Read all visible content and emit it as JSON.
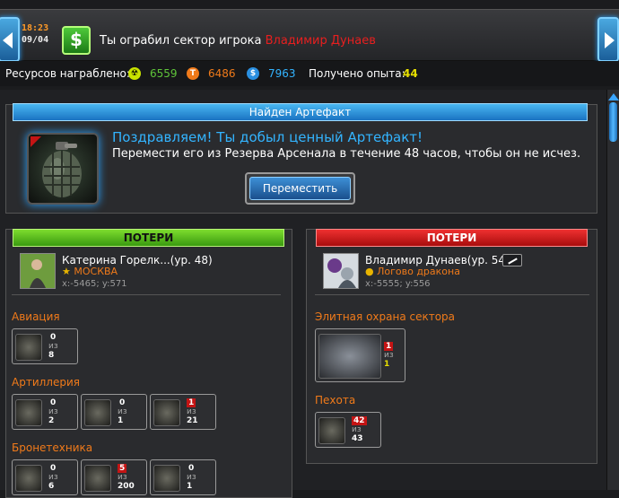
{
  "topbar": {
    "time": "18:23",
    "date": "09/04",
    "event_text": "Ты ограбил сектор игрока",
    "event_player": "Владимир Дунаев",
    "cash_icon": "dollar-sign-icon"
  },
  "resources": {
    "label": "Ресурсов награблено:",
    "items": [
      {
        "icon": "radiation-icon",
        "value": "6559",
        "color": "#5fc43a"
      },
      {
        "icon": "titanium-icon",
        "value": "6486",
        "color": "#f07a1a"
      },
      {
        "icon": "credits-icon",
        "value": "7963",
        "color": "#33b4ff"
      }
    ],
    "exp_label": "Получено опыта:",
    "exp_value": "44",
    "exp_color": "#e8e000"
  },
  "artifact": {
    "header": "Найден Артефакт",
    "title": "Поздравляем! Ты добыл ценный Артефакт!",
    "desc": "Перемести его из Резерва Арсенала в течение 48 часов, чтобы он не исчез.",
    "move_button": "Переместить"
  },
  "left": {
    "header": "ПОТЕРИ",
    "player": {
      "name": "Катерина Горелк...(ур. 48)",
      "city": "МОСКВА",
      "coords": "x:-5465; y:571"
    },
    "categories": [
      {
        "name": "Авиация",
        "units": [
          {
            "count": "0",
            "of": "из",
            "total": "8",
            "loss": false
          }
        ]
      },
      {
        "name": "Артиллерия",
        "units": [
          {
            "count": "0",
            "of": "из",
            "total": "2",
            "loss": false
          },
          {
            "count": "0",
            "of": "из",
            "total": "1",
            "loss": false
          },
          {
            "count": "1",
            "of": "из",
            "total": "21",
            "loss": true
          }
        ]
      },
      {
        "name": "Бронетехника",
        "units": [
          {
            "count": "0",
            "of": "из",
            "total": "6",
            "loss": false
          },
          {
            "count": "5",
            "of": "из",
            "total": "200",
            "loss": true
          },
          {
            "count": "0",
            "of": "из",
            "total": "1",
            "loss": false
          }
        ]
      }
    ]
  },
  "right": {
    "header": "ПОТЕРИ",
    "player": {
      "name": "Владимир Дунаев(ур. 54)",
      "city": "Логово дракона",
      "coords": "x:-5555; y:556"
    },
    "categories": [
      {
        "name": "Элитная охрана сектора",
        "units": [
          {
            "count": "1",
            "of": "из",
            "total": "1",
            "loss": true
          }
        ]
      },
      {
        "name": "Пехота",
        "units": [
          {
            "count": "42",
            "of": "из",
            "total": "43",
            "loss": true
          }
        ]
      }
    ]
  }
}
